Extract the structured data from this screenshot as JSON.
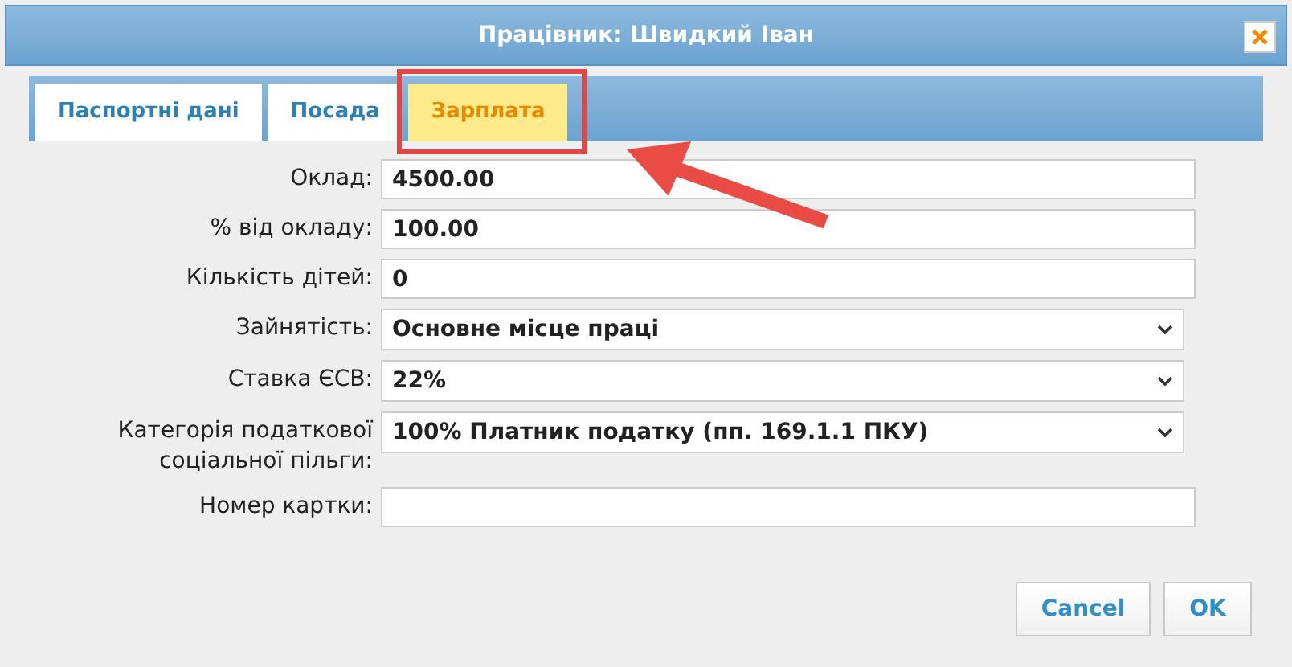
{
  "window": {
    "title": "Працівник: Швидкий Іван"
  },
  "tabs": [
    {
      "label": "Паспортні дані",
      "selected": false
    },
    {
      "label": "Посада",
      "selected": false
    },
    {
      "label": "Зарплата",
      "selected": true
    }
  ],
  "fields": [
    {
      "kind": "input",
      "label": "Оклад:",
      "value": "4500.00"
    },
    {
      "kind": "input",
      "label": "% від окладу:",
      "value": "100.00"
    },
    {
      "kind": "input",
      "label": "Кількість дітей:",
      "value": "0"
    },
    {
      "kind": "select",
      "label": "Зайнятість:",
      "value": "Основне місце праці"
    },
    {
      "kind": "select",
      "label": "Ставка ЄСВ:",
      "value": "22%"
    },
    {
      "kind": "select",
      "label": "Категорія податкової соціальної пільги:",
      "value": "100% Платник податку (пп. 169.1.1 ПКУ)"
    },
    {
      "kind": "input",
      "label": "Номер картки:"
    }
  ],
  "buttons": [
    "Cancel",
    "OK"
  ]
}
